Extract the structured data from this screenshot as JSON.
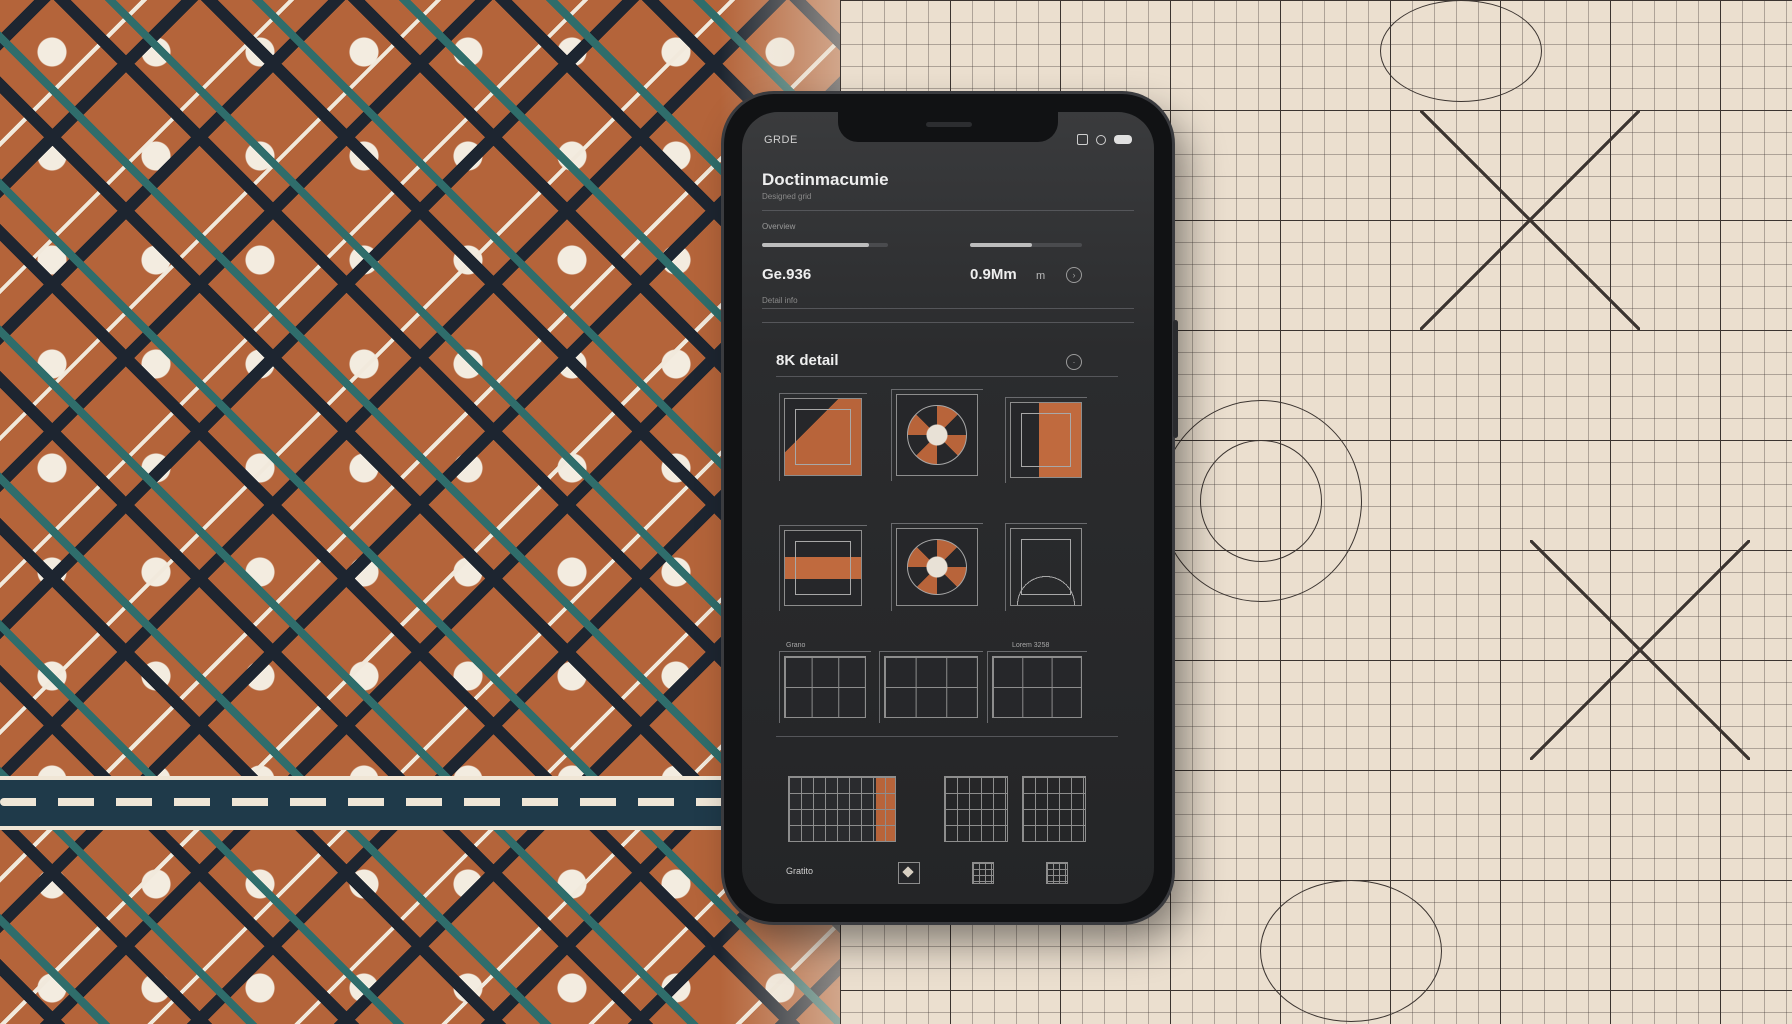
{
  "status_bar": {
    "carrier": "GRDE",
    "icons": [
      "square-icon",
      "circle-icon",
      "battery-icon"
    ]
  },
  "header": {
    "title": "Doctinmacumie",
    "subtitle": "Designed grid",
    "section_label": "Overview"
  },
  "progress": [
    {
      "name": "left-progress",
      "fraction": 0.85
    },
    {
      "name": "right-progress",
      "fraction": 0.55
    }
  ],
  "stats": {
    "left_value": "Ge.936",
    "right_value": "0.9Mm",
    "right_unit": "m",
    "caption": "Detail info"
  },
  "detail": {
    "label": "8K detail",
    "info_icon": "info-circle-icon",
    "thumbnails": [
      {
        "name": "tile-copper-corner",
        "swatch": "copper"
      },
      {
        "name": "tile-star-medallion",
        "swatch": "star"
      },
      {
        "name": "tile-copper-half",
        "swatch": "half"
      },
      {
        "name": "tile-copper-bar",
        "swatch": "bar"
      },
      {
        "name": "tile-star-medallion-2",
        "swatch": "star"
      },
      {
        "name": "tile-arc-lines",
        "swatch": "arc"
      },
      {
        "name": "tile-line-grid",
        "swatch": "grid"
      },
      {
        "name": "tile-wave-grid",
        "swatch": "grid"
      },
      {
        "name": "tile-plain-grid",
        "swatch": "grid"
      }
    ],
    "thumb_labels": [
      "Grano",
      "Lorem 3258"
    ]
  },
  "bottom_nav": {
    "label": "Gratito",
    "icons": [
      "diamond-icon",
      "grid-icon",
      "grid-icon"
    ]
  },
  "colors": {
    "accent_copper": "#b8643a",
    "screen_bg": "#2b2c2e",
    "text_primary": "#eeeeee",
    "teal": "#2f6d6b"
  }
}
